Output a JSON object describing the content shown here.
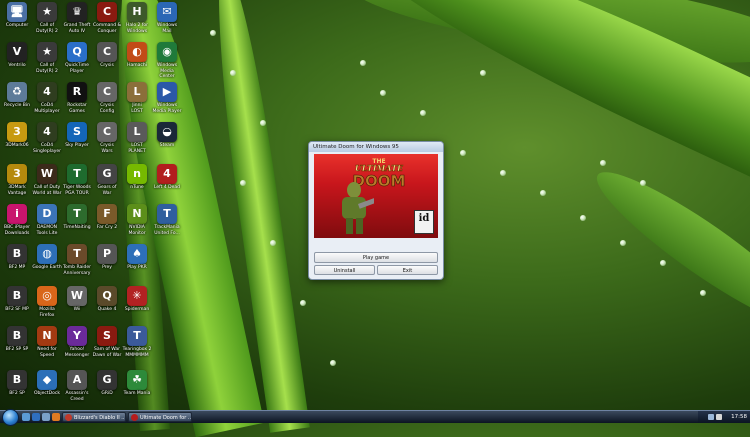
{
  "desktop": {
    "icons": [
      {
        "label": "Computer",
        "glyph": "🖥",
        "color": "#4a6fa5"
      },
      {
        "label": "Call of\nDuty(R) 2",
        "glyph": "★",
        "color": "#3a3a3a"
      },
      {
        "label": "Grand Theft\nAuto IV",
        "glyph": "♛",
        "color": "#222222"
      },
      {
        "label": "Command &\nConquer",
        "glyph": "C",
        "color": "#8a1a10"
      },
      {
        "label": "Halo 2 for\nWindows",
        "glyph": "H",
        "color": "#3d5a2a"
      },
      {
        "label": "Windows\nMail",
        "glyph": "✉",
        "color": "#2b67b5"
      },
      {
        "label": "Ventrilo",
        "glyph": "V",
        "color": "#222222"
      },
      {
        "label": "Call of\nDuty(R) 2",
        "glyph": "★",
        "color": "#3a3a3a"
      },
      {
        "label": "QuickTime\nPlayer",
        "glyph": "Q",
        "color": "#2a6fc9"
      },
      {
        "label": "Crysis",
        "glyph": "C",
        "color": "#555555"
      },
      {
        "label": "Hamachi",
        "glyph": "◐",
        "color": "#c24b17"
      },
      {
        "label": "Windows\nMedia Center",
        "glyph": "◉",
        "color": "#1f7a3a"
      },
      {
        "label": "Recycle Bin",
        "glyph": "♻",
        "color": "#5d7b99"
      },
      {
        "label": "CoD4\nMultiplayer",
        "glyph": "4",
        "color": "#2f3d1f"
      },
      {
        "label": "Rockstar\nGames",
        "glyph": "R",
        "color": "#111111"
      },
      {
        "label": "Crysis\nConfig",
        "glyph": "C",
        "color": "#666666"
      },
      {
        "label": "Jinni\nLOST",
        "glyph": "L",
        "color": "#8b6f3a"
      },
      {
        "label": "Windows\nMedia Player",
        "glyph": "▶",
        "color": "#2b58a8"
      },
      {
        "label": "3DMark06",
        "glyph": "3",
        "color": "#c79a11"
      },
      {
        "label": "CoD4\nSingleplayer",
        "glyph": "4",
        "color": "#2f3d1f"
      },
      {
        "label": "Sky Player",
        "glyph": "S",
        "color": "#1466b8"
      },
      {
        "label": "Crysis\nWars",
        "glyph": "C",
        "color": "#666666"
      },
      {
        "label": "LOST\nPLANET",
        "glyph": "L",
        "color": "#5a5a5a"
      },
      {
        "label": "Steam",
        "glyph": "◒",
        "color": "#1b2838"
      },
      {
        "label": "3DMark\nVantage",
        "glyph": "3",
        "color": "#b58a0d"
      },
      {
        "label": "Call of Duty\nWorld at War",
        "glyph": "W",
        "color": "#3b2a1a"
      },
      {
        "label": "Tiger Woods\nPGA TOUR",
        "glyph": "T",
        "color": "#1e6b2e"
      },
      {
        "label": "Gears of\nWar",
        "glyph": "G",
        "color": "#444444"
      },
      {
        "label": "nTune",
        "glyph": "n",
        "color": "#76b900"
      },
      {
        "label": "Left 4 Dead",
        "glyph": "4",
        "color": "#b21e1e"
      },
      {
        "label": "BBC iPlayer\nDownloads",
        "glyph": "i",
        "color": "#c8156d"
      },
      {
        "label": "DAEMON\nTools Lite",
        "glyph": "D",
        "color": "#3b74b8"
      },
      {
        "label": "TimeNaiting",
        "glyph": "T",
        "color": "#2d6b2d"
      },
      {
        "label": "Far Cry 2",
        "glyph": "F",
        "color": "#7a5a2a"
      },
      {
        "label": "NVIDIA\nMonitor",
        "glyph": "N",
        "color": "#5c8f1a"
      },
      {
        "label": "TrackMania\nUnited Fo...",
        "glyph": "T",
        "color": "#2f5f9e"
      },
      {
        "label": "BF2 MP",
        "glyph": "B",
        "color": "#333333"
      },
      {
        "label": "Google Earth",
        "glyph": "◍",
        "color": "#2d6fb8"
      },
      {
        "label": "Tomb Raider\nAnniversary",
        "glyph": "T",
        "color": "#6b4a2a"
      },
      {
        "label": "Prey",
        "glyph": "P",
        "color": "#555555"
      },
      {
        "label": "Play PKR",
        "glyph": "♠",
        "color": "#2d6fb8"
      },
      {
        "label": "",
        "glyph": "",
        "color": "transparent"
      },
      {
        "label": "BF2 SF MP",
        "glyph": "B",
        "color": "#333333"
      },
      {
        "label": "Mozilla\nFirefox",
        "glyph": "◎",
        "color": "#d9661a"
      },
      {
        "label": "Wii",
        "glyph": "W",
        "color": "#666666"
      },
      {
        "label": "Quake 4",
        "glyph": "Q",
        "color": "#5a4a2a"
      },
      {
        "label": "Spiderman",
        "glyph": "✳",
        "color": "#b22222"
      },
      {
        "label": "",
        "glyph": "",
        "color": "transparent"
      },
      {
        "label": "BF2 SP SP",
        "glyph": "B",
        "color": "#333333"
      },
      {
        "label": "Need for\nSpeed",
        "glyph": "N",
        "color": "#a33a12"
      },
      {
        "label": "Yahoo!\nMessenger",
        "glyph": "Y",
        "color": "#6b2a9a"
      },
      {
        "label": "Sam of War\nDawn of War",
        "glyph": "S",
        "color": "#8a1a10"
      },
      {
        "label": "Tearingbox 2\nMMMMMM",
        "glyph": "T",
        "color": "#3b5a9a"
      },
      {
        "label": "",
        "glyph": "",
        "color": "transparent"
      },
      {
        "label": "BF2 SP",
        "glyph": "B",
        "color": "#333333"
      },
      {
        "label": "ObjectDock",
        "glyph": "◆",
        "color": "#2b6fb8"
      },
      {
        "label": "Assassin's\nCreed",
        "glyph": "A",
        "color": "#555555"
      },
      {
        "label": "GRiD",
        "glyph": "G",
        "color": "#333333"
      },
      {
        "label": "Team Mania",
        "glyph": "☘",
        "color": "#2d8a3a"
      },
      {
        "label": "",
        "glyph": "",
        "color": "transparent"
      }
    ]
  },
  "launcher": {
    "title": "Ultimate Doom for Windows 95",
    "logo_line1": "THE",
    "logo_line2": "ULTIMATE",
    "logo_line3": "DOOM",
    "id_badge": "id",
    "play_label": "Play game",
    "uninstall_label": "Uninstall",
    "exit_label": "Exit"
  },
  "taskbar": {
    "tasks": [
      {
        "label": "Blizzard's Diablo II ...",
        "color": "#c0392b"
      },
      {
        "label": "Ultimate Doom for ...",
        "color": "#b71c1c"
      }
    ],
    "clock": "17:58"
  }
}
